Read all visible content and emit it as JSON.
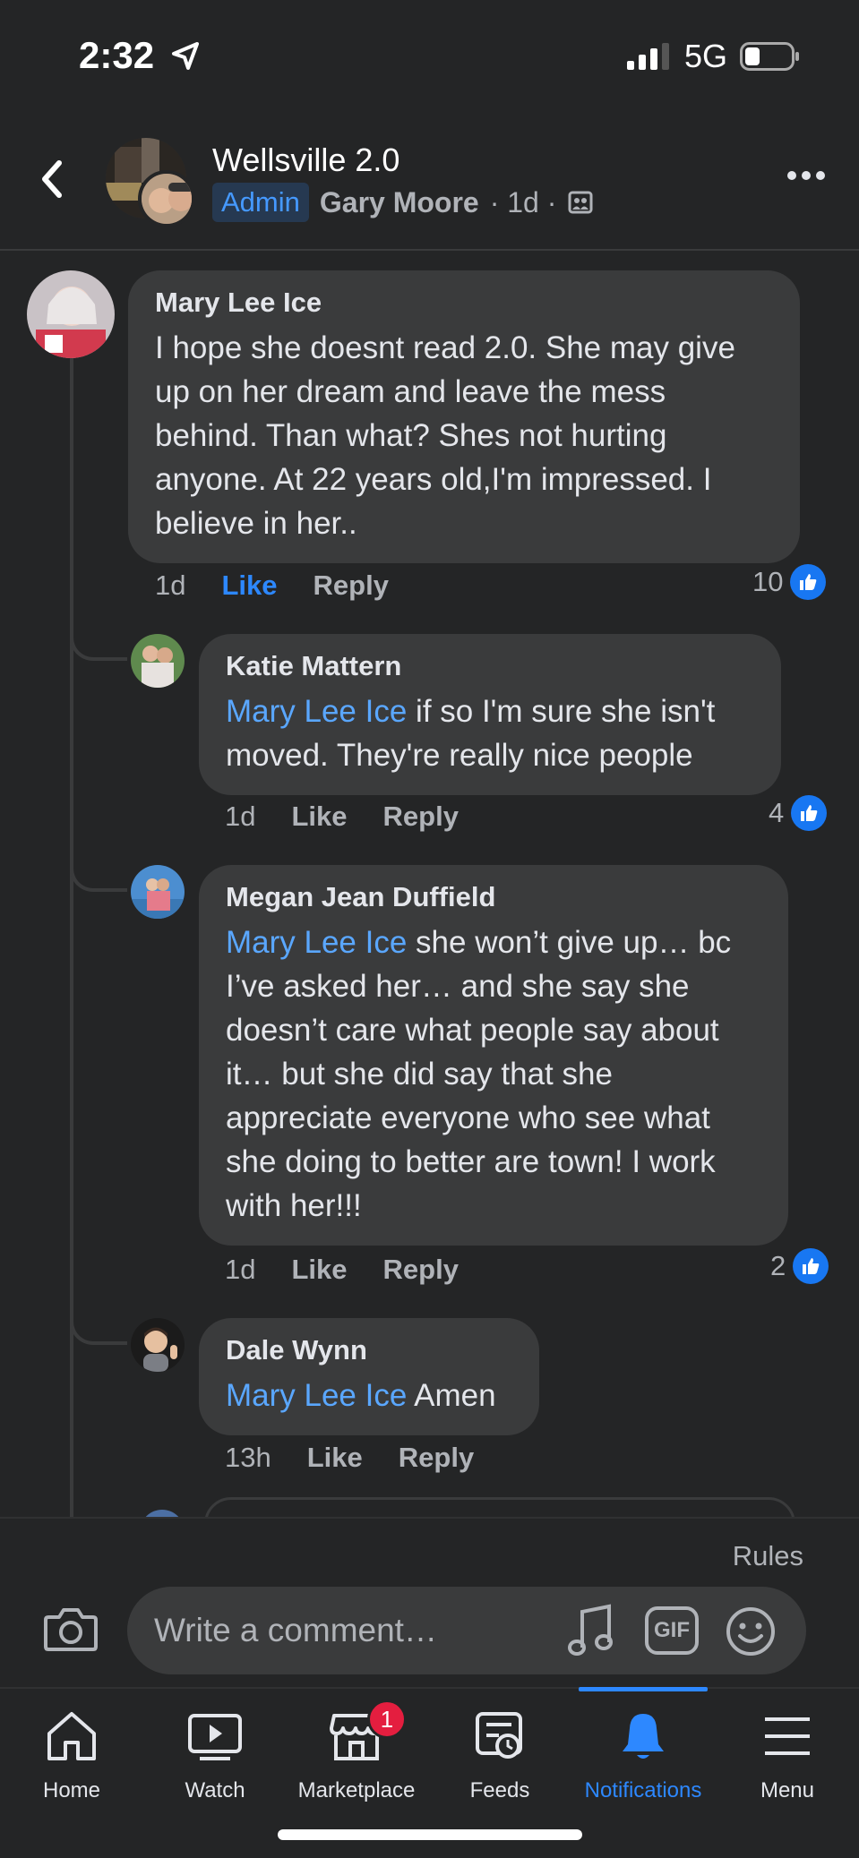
{
  "status": {
    "time": "2:32",
    "network": "5G"
  },
  "header": {
    "group_name": "Wellsville 2.0",
    "badge": "Admin",
    "poster": "Gary Moore",
    "age": "· 1d ·"
  },
  "comments": [
    {
      "author": "Mary Lee Ice",
      "text": "I hope she doesnt read 2.0. She may give up on her dream and leave the mess behind. Than what?  Shes not hurting anyone. At 22 years old,I'm impressed.  I believe in her..",
      "time": "1d",
      "like": "Like",
      "reply": "Reply",
      "reactions": "10"
    },
    {
      "author": "Katie Mattern",
      "mention": "Mary Lee Ice",
      "text": " if so I'm sure she isn't moved. They're really nice people",
      "time": "1d",
      "like": "Like",
      "reply": "Reply",
      "reactions": "4"
    },
    {
      "author": "Megan Jean Duffield",
      "mention": "Mary Lee Ice",
      "text": " she won’t give up… bc I’ve asked her… and she say she doesn’t care what people say about it… but she did say that she appreciate everyone who see what she doing to better are town! I work with her!!!",
      "time": "1d",
      "like": "Like",
      "reply": "Reply",
      "reactions": "2"
    },
    {
      "author": "Dale Wynn",
      "mention": "Mary Lee Ice",
      "text": " Amen",
      "time": "13h",
      "like": "Like",
      "reply": "Reply"
    }
  ],
  "composer": {
    "rules": "Rules",
    "placeholder": "Write a comment…",
    "gif": "GIF"
  },
  "tabs": [
    {
      "label": "Home",
      "icon": "home-icon"
    },
    {
      "label": "Watch",
      "icon": "watch-icon"
    },
    {
      "label": "Marketplace",
      "icon": "marketplace-icon",
      "badge": "1"
    },
    {
      "label": "Feeds",
      "icon": "feeds-icon"
    },
    {
      "label": "Notifications",
      "icon": "bell-icon",
      "active": true
    },
    {
      "label": "Menu",
      "icon": "menu-icon"
    }
  ],
  "colors": {
    "accent": "#2d88ff",
    "mention": "#5aa7ff",
    "background": "#242526",
    "bubble": "#3a3b3c"
  }
}
